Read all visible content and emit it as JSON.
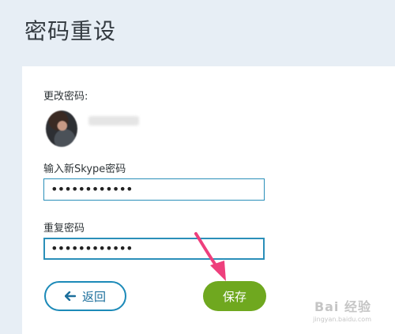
{
  "page": {
    "title": "密码重设"
  },
  "form": {
    "change_password_label": "更改密码:",
    "new_password_label": "输入新Skype密码",
    "new_password_value": "••••••••••••",
    "confirm_password_label": "重复密码",
    "confirm_password_value": "••••••••••••"
  },
  "buttons": {
    "back_label": "返回",
    "back_icon": "arrow-left-icon",
    "save_label": "保存"
  },
  "annotation": {
    "pointer_color": "#ee3f7c"
  },
  "watermark": {
    "main": "Bai 经验",
    "sub": "jingyan.baidu.com"
  },
  "colors": {
    "accent": "#2a8fb9",
    "save_button": "#6fa81f",
    "header_bg": "#e7eef5"
  }
}
